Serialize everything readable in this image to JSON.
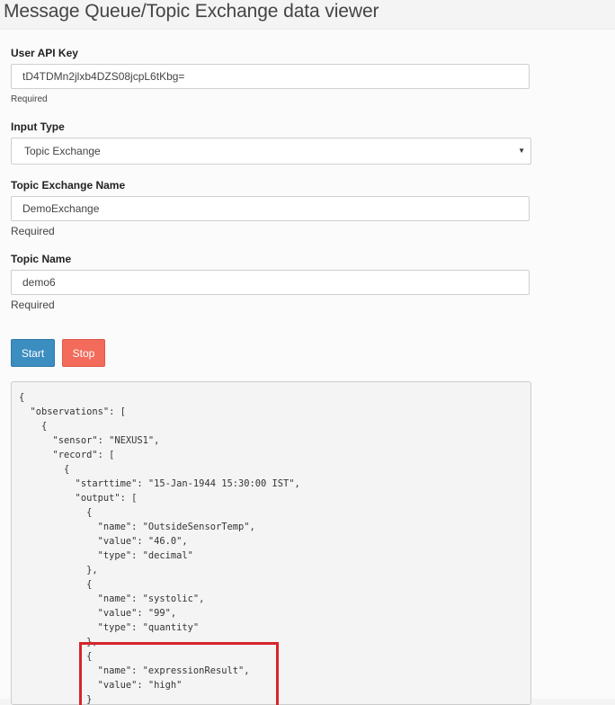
{
  "page": {
    "title": "Message Queue/Topic Exchange data viewer"
  },
  "form": {
    "api_key": {
      "label": "User API Key",
      "value": "tD4TDMn2jlxb4DZS08jcpL6tKbg=",
      "help": "Required"
    },
    "input_type": {
      "label": "Input Type",
      "selected": "Topic Exchange"
    },
    "exchange_name": {
      "label": "Topic Exchange Name",
      "value": "DemoExchange",
      "help": "Required"
    },
    "topic_name": {
      "label": "Topic Name",
      "value": "demo6",
      "help": "Required"
    }
  },
  "buttons": {
    "start_label": "Start",
    "stop_label": "Stop"
  },
  "output": {
    "json_text": "{\n  \"observations\": [\n    {\n      \"sensor\": \"NEXUS1\",\n      \"record\": [\n        {\n          \"starttime\": \"15-Jan-1944 15:30:00 IST\",\n          \"output\": [\n            {\n              \"name\": \"OutsideSensorTemp\",\n              \"value\": \"46.0\",\n              \"type\": \"decimal\"\n            },\n            {\n              \"name\": \"systolic\",\n              \"value\": \"99\",\n              \"type\": \"quantity\"\n            },\n            {\n              \"name\": \"expressionResult\",\n              \"value\": \"high\"\n            }"
  },
  "colors": {
    "start_button": "#3c8dc0",
    "stop_button": "#f26b5b",
    "highlight": "#d7242b"
  },
  "icons": {
    "select_arrow": "caret-down-icon"
  }
}
